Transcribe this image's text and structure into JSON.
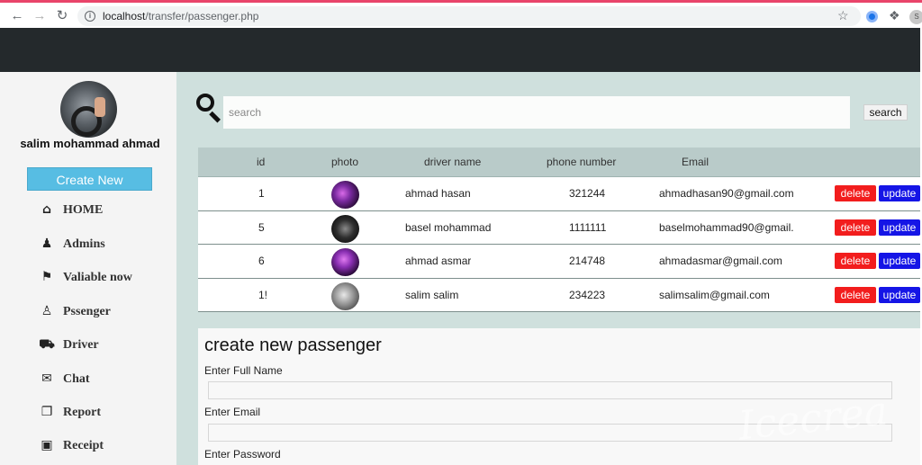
{
  "browser": {
    "url_host": "localhost",
    "url_path": "/transfer/passenger.php",
    "profile_initial": "S"
  },
  "sidebar": {
    "user_name": "salim mohammad ahmad",
    "create_label": "Create New",
    "items": [
      {
        "label": "HOME",
        "icon": "home-icon"
      },
      {
        "label": "Admins",
        "icon": "user-tie-icon"
      },
      {
        "label": "Valiable now",
        "icon": "map-marker-icon"
      },
      {
        "label": "Pssenger",
        "icon": "person-icon"
      },
      {
        "label": "Driver",
        "icon": "car-icon"
      },
      {
        "label": "Chat",
        "icon": "comments-icon"
      },
      {
        "label": "Report",
        "icon": "copy-icon"
      },
      {
        "label": "Receipt",
        "icon": "money-bill-icon"
      }
    ]
  },
  "search": {
    "placeholder": "search",
    "button_label": "search"
  },
  "table": {
    "headers": [
      "id",
      "photo",
      "driver name",
      "phone number",
      "Email"
    ],
    "rows": [
      {
        "id": "1",
        "name": "ahmad hasan",
        "phone": "321244",
        "email": "ahmadhasan90@gmail.com"
      },
      {
        "id": "5",
        "name": "basel mohammad",
        "phone": "1111111",
        "email": "baselmohammad90@gmail."
      },
      {
        "id": "6",
        "name": "ahmad asmar",
        "phone": "214748",
        "email": "ahmadasmar@gmail.com"
      },
      {
        "id": "1!",
        "name": "salim salim",
        "phone": "234223",
        "email": "salimsalim@gmail.com"
      }
    ],
    "delete_label": "delete",
    "update_label": "update"
  },
  "form": {
    "title": "create new passenger",
    "fields": [
      {
        "label": "Enter Full Name"
      },
      {
        "label": "Enter Email"
      },
      {
        "label": "Enter Password"
      }
    ]
  },
  "watermark": {
    "text": "Icecrea"
  },
  "colors": {
    "header": "#24292c",
    "main_bg": "#cfe0dd",
    "create_button": "#57bde3",
    "delete_button": "#f21d1d",
    "update_button": "#1515e6"
  }
}
